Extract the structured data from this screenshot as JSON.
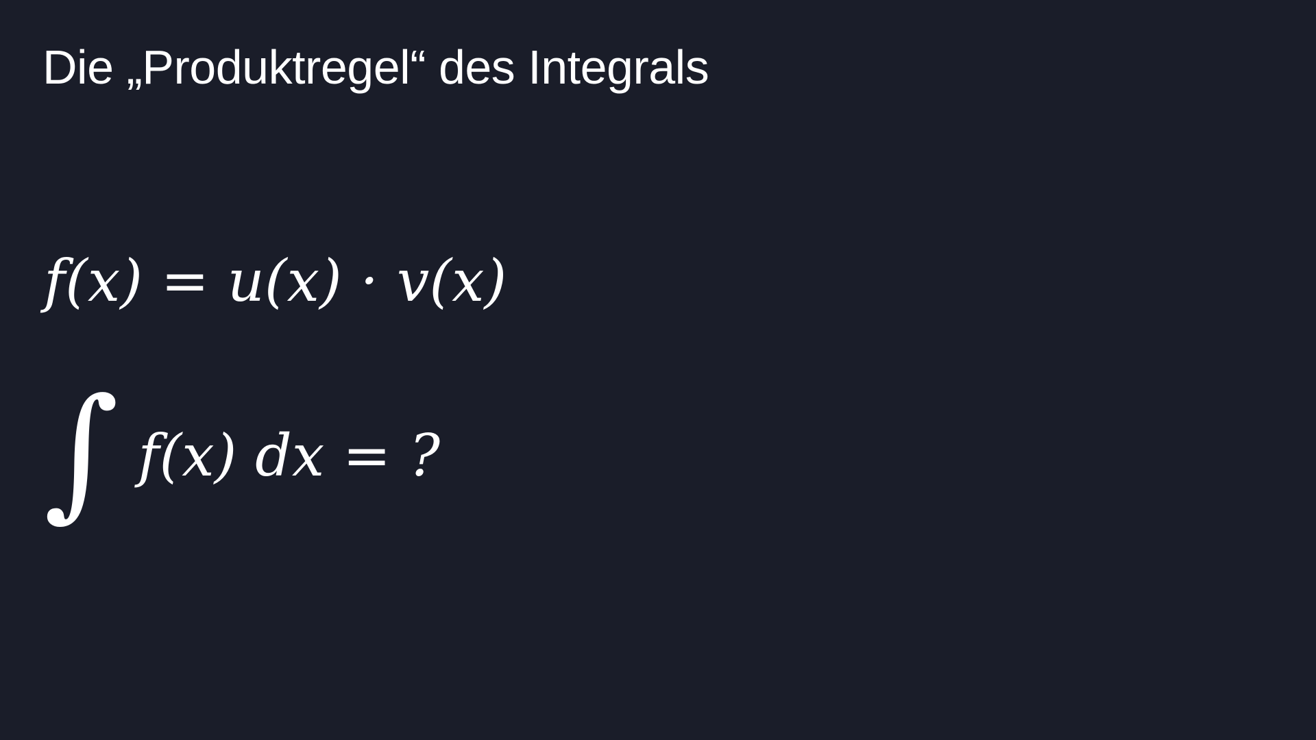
{
  "slide": {
    "title": "Die „Produktregel“ des Integrals",
    "formulas": [
      {
        "text": "f(x) = u(x) · v(x)"
      },
      {
        "integral_symbol": "∫",
        "text": "f(x) dx = ?"
      }
    ]
  },
  "colors": {
    "background": "#1a1d29",
    "text": "#ffffff"
  }
}
